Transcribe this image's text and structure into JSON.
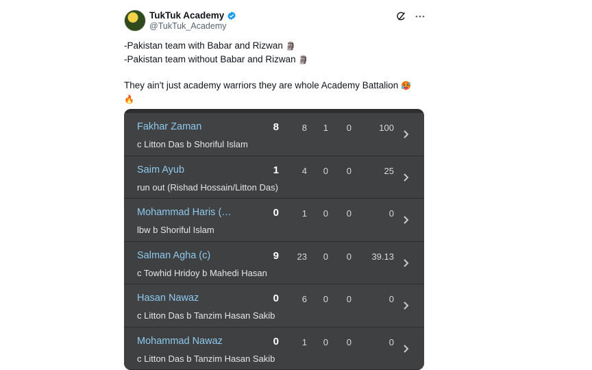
{
  "tweet": {
    "display_name": "TukTuk Academy",
    "handle": "@TukTuk_Academy",
    "lines": [
      "-Pakistan team with Babar and Rizwan",
      "-Pakistan team without Babar and Rizwan"
    ],
    "line_emoji": "🗿",
    "paragraph": "They ain't just academy warriors they are whole Academy Battalion",
    "paragraph_emoji": "🥵",
    "fire_emoji": "🔥"
  },
  "scorecard": {
    "rows": [
      {
        "name": "Fakhar Zaman",
        "dismissal": "c Litton Das b Shoriful Islam",
        "runs": "8",
        "balls": "8",
        "fours": "1",
        "sixes": "0",
        "sr": "100"
      },
      {
        "name": "Saim Ayub",
        "dismissal": "run out (Rishad Hossain/Litton Das)",
        "runs": "1",
        "balls": "4",
        "fours": "0",
        "sixes": "0",
        "sr": "25"
      },
      {
        "name": "Mohammad Haris (…",
        "dismissal": "lbw b Shoriful Islam",
        "runs": "0",
        "balls": "1",
        "fours": "0",
        "sixes": "0",
        "sr": "0"
      },
      {
        "name": "Salman Agha (c)",
        "dismissal": "c Towhid Hridoy b Mahedi Hasan",
        "runs": "9",
        "balls": "23",
        "fours": "0",
        "sixes": "0",
        "sr": "39.13"
      },
      {
        "name": "Hasan Nawaz",
        "dismissal": "c Litton Das b Tanzim Hasan Sakib",
        "runs": "0",
        "balls": "6",
        "fours": "0",
        "sixes": "0",
        "sr": "0"
      },
      {
        "name": "Mohammad Nawaz",
        "dismissal": "c Litton Das b Tanzim Hasan Sakib",
        "runs": "0",
        "balls": "1",
        "fours": "0",
        "sixes": "0",
        "sr": "0"
      }
    ]
  },
  "icons": {
    "verified": "verified-badge-icon",
    "grok": "grok-icon",
    "more": "more-icon",
    "chevron": "chevron-right-icon"
  },
  "colors": {
    "link_blue": "#8ec9ee",
    "verified_blue": "#1d9bf0",
    "card_bg": "#3a3b3c"
  }
}
